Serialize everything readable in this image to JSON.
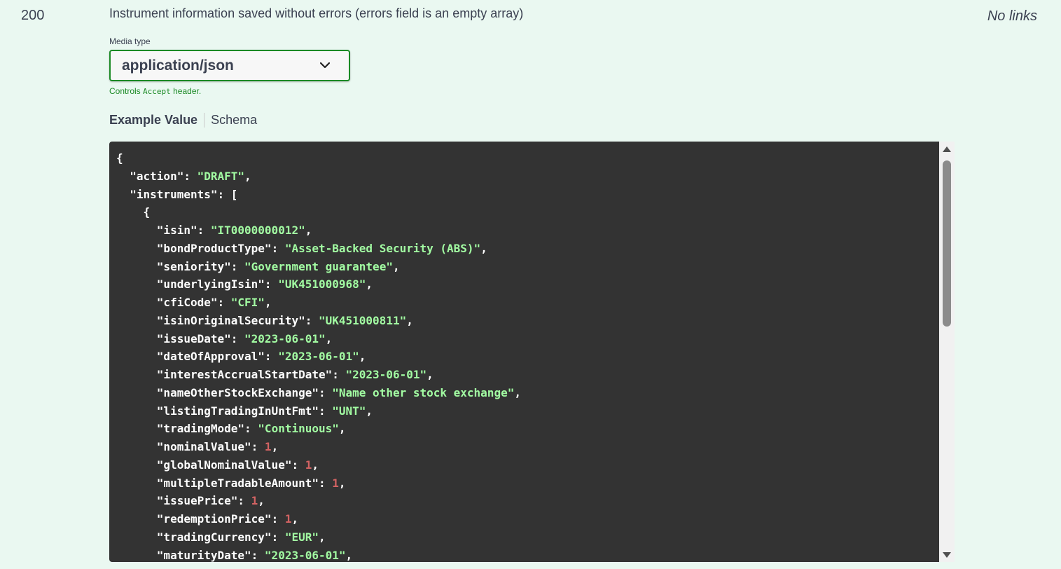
{
  "response": {
    "status_code": "200",
    "description": "Instrument information saved without errors (errors field is an empty array)",
    "links": "No links"
  },
  "media_type": {
    "label": "Media type",
    "selected": "application/json",
    "note_prefix": "Controls",
    "note_code": "Accept",
    "note_suffix": "header."
  },
  "tabs": {
    "example_value": "Example Value",
    "schema": "Schema"
  },
  "example_lines": [
    {
      "indent": 0,
      "key": null,
      "value": null,
      "type": "punct",
      "text": "{"
    },
    {
      "indent": 1,
      "key": "action",
      "value": "DRAFT",
      "type": "string"
    },
    {
      "indent": 1,
      "key": "instruments",
      "value": null,
      "type": "open-array"
    },
    {
      "indent": 2,
      "key": null,
      "value": null,
      "type": "punct",
      "text": "{"
    },
    {
      "indent": 3,
      "key": "isin",
      "value": "IT0000000012",
      "type": "string"
    },
    {
      "indent": 3,
      "key": "bondProductType",
      "value": "Asset-Backed Security (ABS)",
      "type": "string"
    },
    {
      "indent": 3,
      "key": "seniority",
      "value": "Government guarantee",
      "type": "string"
    },
    {
      "indent": 3,
      "key": "underlyingIsin",
      "value": "UK451000968",
      "type": "string"
    },
    {
      "indent": 3,
      "key": "cfiCode",
      "value": "CFI",
      "type": "string"
    },
    {
      "indent": 3,
      "key": "isinOriginalSecurity",
      "value": "UK451000811",
      "type": "string"
    },
    {
      "indent": 3,
      "key": "issueDate",
      "value": "2023-06-01",
      "type": "string"
    },
    {
      "indent": 3,
      "key": "dateOfApproval",
      "value": "2023-06-01",
      "type": "string"
    },
    {
      "indent": 3,
      "key": "interestAccrualStartDate",
      "value": "2023-06-01",
      "type": "string"
    },
    {
      "indent": 3,
      "key": "nameOtherStockExchange",
      "value": "Name other stock exchange",
      "type": "string"
    },
    {
      "indent": 3,
      "key": "listingTradingInUntFmt",
      "value": "UNT",
      "type": "string"
    },
    {
      "indent": 3,
      "key": "tradingMode",
      "value": "Continuous",
      "type": "string"
    },
    {
      "indent": 3,
      "key": "nominalValue",
      "value": "1",
      "type": "number"
    },
    {
      "indent": 3,
      "key": "globalNominalValue",
      "value": "1",
      "type": "number"
    },
    {
      "indent": 3,
      "key": "multipleTradableAmount",
      "value": "1",
      "type": "number"
    },
    {
      "indent": 3,
      "key": "issuePrice",
      "value": "1",
      "type": "number"
    },
    {
      "indent": 3,
      "key": "redemptionPrice",
      "value": "1",
      "type": "number"
    },
    {
      "indent": 3,
      "key": "tradingCurrency",
      "value": "EUR",
      "type": "string"
    },
    {
      "indent": 3,
      "key": "maturityDate",
      "value": "2023-06-01",
      "type": "string"
    }
  ],
  "colors": {
    "background": "#eaf8f1",
    "select_border": "#1b8a25",
    "code_background": "#333333",
    "code_string": "#a2fca2",
    "code_number": "#d36363",
    "code_key": "#ffffff"
  },
  "icons": {
    "select_chevron": "chevron-down-icon",
    "scroll_up": "arrow-up-icon",
    "scroll_down": "arrow-down-icon"
  }
}
